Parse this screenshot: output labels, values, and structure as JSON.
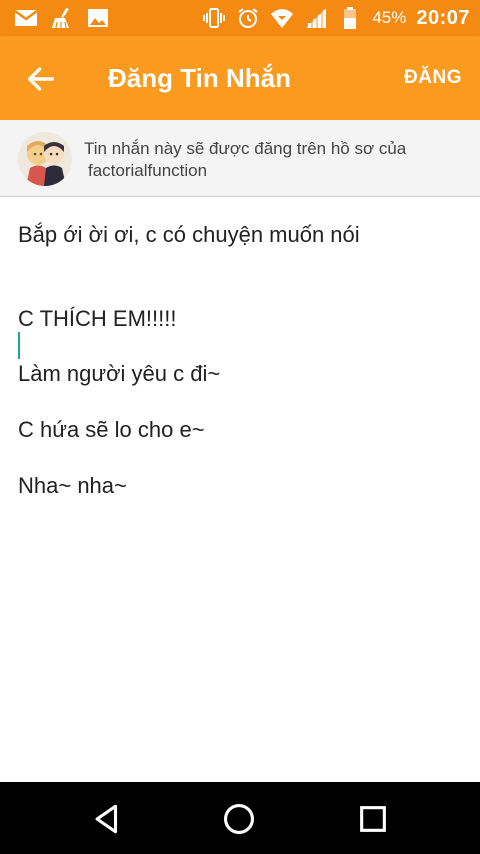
{
  "status_bar": {
    "left_icons": [
      "gmail-icon",
      "cleaner-icon",
      "gallery-icon"
    ],
    "right_icons": [
      "vibrate-icon",
      "alarm-icon",
      "wifi-icon",
      "signal-icon",
      "battery-icon"
    ],
    "battery": "45%",
    "time": "20:07",
    "colors": {
      "background": "#f58a12",
      "foreground": "#ffffff"
    }
  },
  "app_bar": {
    "title": "Đăng Tin Nhắn",
    "action_label": "ĐĂNG",
    "back_icon": "arrow-left-icon",
    "colors": {
      "background": "#fa9a1e",
      "foreground": "#ffffff"
    }
  },
  "info": {
    "line1": "Tin nhắn này sẽ được đăng trên hồ sơ của",
    "username": "factorialfunction"
  },
  "message": {
    "lines": [
      "Bắp ới ời ơi, c có chuyện muốn nói",
      "C THÍCH EM!!!!!",
      "Làm người yêu c đi~",
      "C hứa sẽ lo cho e~",
      "Nha~ nha~"
    ],
    "caret_color": "#1ea59a"
  },
  "nav_bar": {
    "buttons": [
      "back-triangle-icon",
      "home-circle-icon",
      "recents-square-icon"
    ]
  }
}
